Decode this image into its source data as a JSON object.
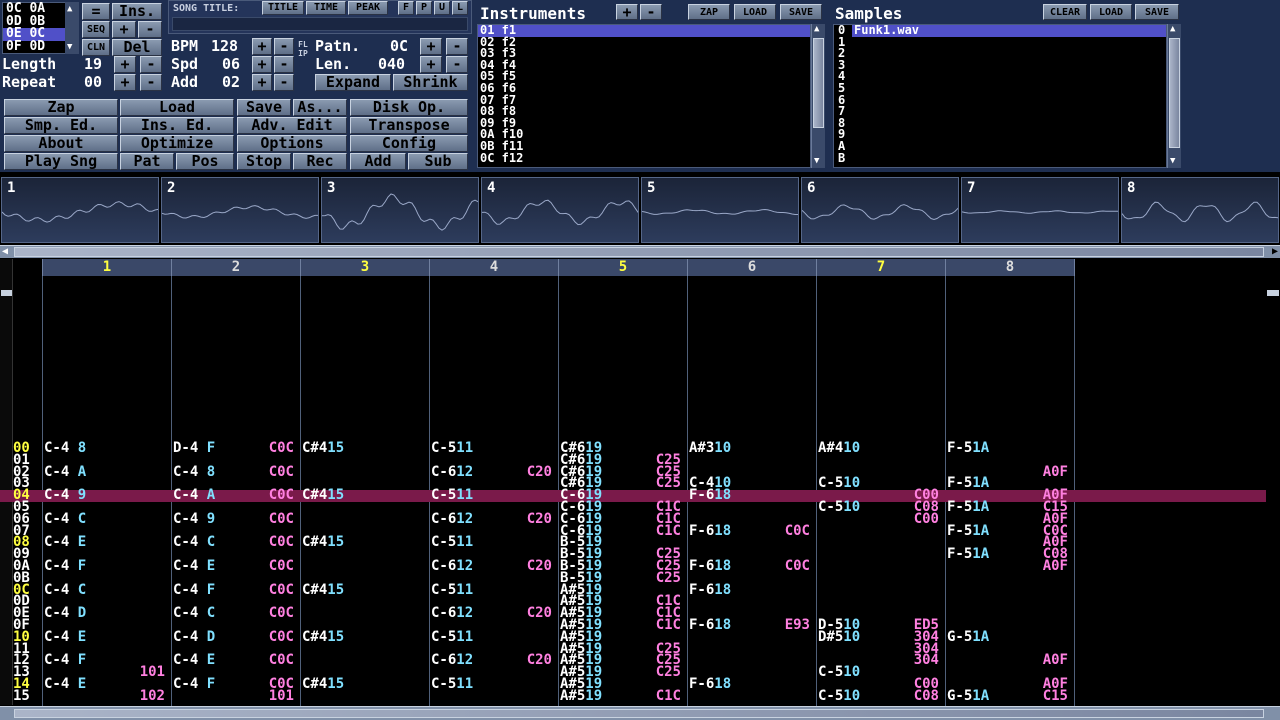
{
  "position_list": {
    "entries": [
      {
        "pos": "0C",
        "pat": "0A"
      },
      {
        "pos": "0D",
        "pat": "0B"
      },
      {
        "pos": "0E",
        "pat": "0C"
      },
      {
        "pos": "0F",
        "pat": "0D"
      }
    ],
    "selected": 2
  },
  "song_buttons": {
    "eq": "=",
    "ins": "Ins.",
    "seq": "SEQ",
    "plus": "+",
    "minus": "-",
    "cln": "CLN",
    "del": "Del"
  },
  "song": {
    "length_label": "Length",
    "length": "19",
    "repeat_label": "Repeat",
    "repeat": "00"
  },
  "title_bar": {
    "song_title_label": "SONG TITLE:",
    "title_btn": "TITLE",
    "time_btn": "TIME",
    "peak_btn": "PEAK",
    "f_btn": "F",
    "p_btn": "P",
    "u_btn": "U",
    "l_btn": "L"
  },
  "params": {
    "bpm_label": "BPM",
    "bpm": "128",
    "spd_label": "Spd",
    "spd": "06",
    "add_label": "Add",
    "add": "02",
    "patn_label": "Patn.",
    "patn": "0C",
    "len_label": "Len.",
    "len": "040",
    "flip": "FLIP",
    "expand": "Expand",
    "shrink": "Shrink"
  },
  "menu": {
    "zap": "Zap",
    "load": "Load",
    "save": "Save",
    "as": "As...",
    "disk": "Disk Op.",
    "smp_ed": "Smp. Ed.",
    "ins_ed": "Ins. Ed.",
    "adv_edit": "Adv. Edit",
    "transpose": "Transpose",
    "about": "About",
    "optimize": "Optimize",
    "options": "Options",
    "config": "Config",
    "play_sng": "Play Sng",
    "pat": "Pat",
    "pos": "Pos",
    "stop": "Stop",
    "rec": "Rec",
    "add": "Add",
    "sub": "Sub"
  },
  "instruments": {
    "title": "Instruments",
    "plus": "+",
    "minus": "-",
    "zap": "ZAP",
    "load": "LOAD",
    "save": "SAVE",
    "items": [
      "01 f1",
      "02 f2",
      "03 f3",
      "04 f4",
      "05 f5",
      "06 f6",
      "07 f7",
      "08 f8",
      "09 f9",
      "0A f10",
      "0B f11",
      "0C f12"
    ],
    "selected": 0
  },
  "samples": {
    "title": "Samples",
    "clear": "CLEAR",
    "load": "LOAD",
    "save": "SAVE",
    "numbers": [
      "0",
      "1",
      "2",
      "3",
      "4",
      "5",
      "6",
      "7",
      "8",
      "9",
      "A",
      "B"
    ],
    "items": [
      "Funk1.wav"
    ],
    "selected": 0
  },
  "scopes": [
    "1",
    "2",
    "3",
    "4",
    "5",
    "6",
    "7",
    "8"
  ],
  "channels": {
    "labels": [
      "1",
      "2",
      "3",
      "4",
      "5",
      "6",
      "7",
      "8"
    ],
    "active": [
      0,
      2,
      4,
      6
    ]
  },
  "pattern": {
    "cursor_row": 4,
    "rows": [
      {
        "n": "00",
        "c": [
          "C-4 8 ....",
          "D-4 F  C0C",
          "C#415 ....",
          "C-511 ....",
          "C#619 ....",
          "A#310 ....",
          "A#410 ....",
          "F-51A ...."
        ]
      },
      {
        "n": "01",
        "c": [
          "........",
          "........",
          "........",
          "........",
          "C#619 C25",
          "........",
          "........",
          "........"
        ]
      },
      {
        "n": "02",
        "c": [
          "C-4 A ....",
          "C-4 8  C0C",
          "........",
          "C-612 C20",
          "C#619 C25",
          "........",
          "........",
          "....  A0F"
        ]
      },
      {
        "n": "03",
        "c": [
          "........",
          "........",
          "........",
          "........",
          "C#619 C25",
          "C-410 ....",
          "C-510 ....",
          "F-51A ...."
        ]
      },
      {
        "n": "04",
        "c": [
          "C-4 9 ....",
          "C-4 A  C0C",
          "C#415 ....",
          "C-511 ....",
          "C-619 ....",
          "F-618 ....",
          "....  C00",
          "....  A0F"
        ]
      },
      {
        "n": "05",
        "c": [
          "........",
          "........",
          "........",
          "........",
          "C-619 C1C",
          "........",
          "C-510 C08",
          "F-51A C15"
        ]
      },
      {
        "n": "06",
        "c": [
          "C-4 C ....",
          "C-4 9  C0C",
          "........",
          "C-612 C20",
          "C-619 C1C",
          "........",
          "....  C00",
          "....  A0F"
        ]
      },
      {
        "n": "07",
        "c": [
          "........",
          "........",
          "........",
          "........",
          "C-619 C1C",
          "F-618 C0C",
          "........",
          "F-51A C0C"
        ]
      },
      {
        "n": "08",
        "c": [
          "C-4 E ....",
          "C-4 C  C0C",
          "C#415 ....",
          "C-511 ....",
          "B-519 ....",
          "........",
          "........",
          "....  A0F"
        ]
      },
      {
        "n": "09",
        "c": [
          "........",
          "........",
          "........",
          "........",
          "B-519 C25",
          "........",
          "........",
          "F-51A C08"
        ]
      },
      {
        "n": "0A",
        "c": [
          "C-4 F ....",
          "C-4 E  C0C",
          "........",
          "C-612 C20",
          "B-519 C25",
          "F-618 C0C",
          "........",
          "....  A0F"
        ]
      },
      {
        "n": "0B",
        "c": [
          "........",
          "........",
          "........",
          "........",
          "B-519 C25",
          "........",
          "........",
          "........"
        ]
      },
      {
        "n": "0C",
        "c": [
          "C-4 C ....",
          "C-4 F  C0C",
          "C#415 ....",
          "C-511 ....",
          "A#519 ....",
          "F-618 ....",
          "........",
          "........"
        ]
      },
      {
        "n": "0D",
        "c": [
          "........",
          "........",
          "........",
          "........",
          "A#519 C1C",
          "........",
          "........",
          "........"
        ]
      },
      {
        "n": "0E",
        "c": [
          "C-4 D ....",
          "C-4 C  C0C",
          "........",
          "C-612 C20",
          "A#519 C1C",
          "........",
          "........",
          "........"
        ]
      },
      {
        "n": "0F",
        "c": [
          "........",
          "........",
          "........",
          "........",
          "A#519 C1C",
          "F-618 E93",
          "D-510 ED5",
          "........"
        ]
      },
      {
        "n": "10",
        "c": [
          "C-4 E ....",
          "C-4 D  C0C",
          "C#415 ....",
          "C-511 ....",
          "A#519 ....",
          "........",
          "D#510 304",
          "G-51A ...."
        ]
      },
      {
        "n": "11",
        "c": [
          "........",
          "........",
          "........",
          "........",
          "A#519 C25",
          "........",
          "....  304",
          "........"
        ]
      },
      {
        "n": "12",
        "c": [
          "C-4 F ....",
          "C-4 E  C0C",
          "........",
          "C-612 C20",
          "A#519 C25",
          "........",
          "....  304",
          "....  A0F"
        ]
      },
      {
        "n": "13",
        "c": [
          "....  101",
          "........",
          "........",
          "........",
          "A#519 C25",
          "........",
          "C-510 ....",
          "........"
        ]
      },
      {
        "n": "14",
        "c": [
          "C-4 E ....",
          "C-4 F  C0C",
          "C#415 ....",
          "C-511 ....",
          "A#519 ....",
          "F-618 ....",
          "....  C00",
          "....  A0F"
        ]
      },
      {
        "n": "15",
        "c": [
          "....  102",
          "....  101",
          "........",
          "........",
          "A#519 C1C",
          "........",
          "C-510 C08",
          "G-51A C15"
        ]
      }
    ]
  }
}
